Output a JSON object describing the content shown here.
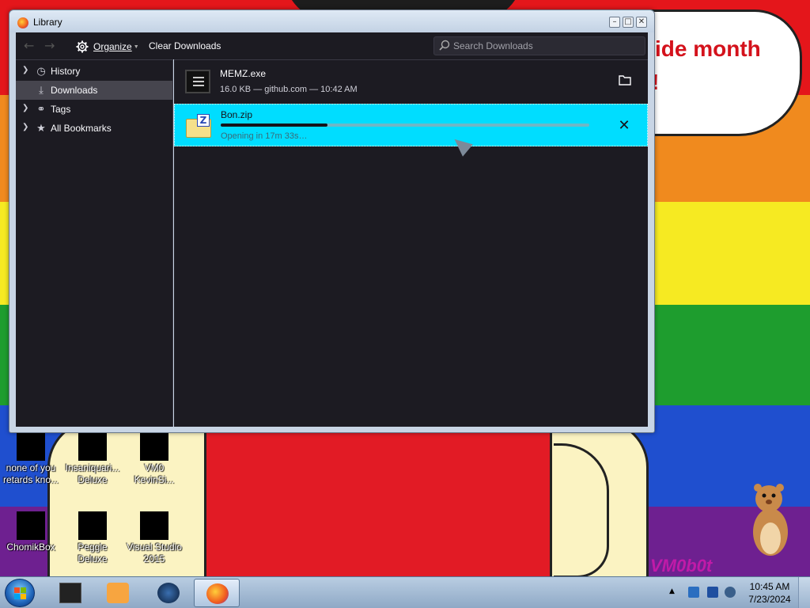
{
  "window": {
    "title": "Library",
    "controls": {
      "minimize": "–",
      "restore": "□",
      "close": "✕"
    }
  },
  "toolbar": {
    "organize_label": "Organize",
    "clear_label": "Clear Downloads",
    "search_placeholder": "Search Downloads"
  },
  "sidebar": {
    "items": [
      {
        "label": "History",
        "icon": "history-icon",
        "expandable": true,
        "selected": false
      },
      {
        "label": "Downloads",
        "icon": "download-icon",
        "expandable": false,
        "selected": true
      },
      {
        "label": "Tags",
        "icon": "tags-icon",
        "expandable": true,
        "selected": false
      },
      {
        "label": "All Bookmarks",
        "icon": "star-icon",
        "expandable": true,
        "selected": false
      }
    ]
  },
  "downloads": [
    {
      "name": "MEMZ.exe",
      "status": "16.0 KB — github.com — 10:42 AM",
      "action": "open-folder"
    },
    {
      "name": "Bon.zip",
      "status": "Opening in 17m 33s…",
      "progress": 0.29,
      "action": "cancel"
    }
  ],
  "desktop": {
    "bubble_line1": "ide month",
    "bubble_line2": "!",
    "icons": [
      {
        "label": "none of you retards kno..."
      },
      {
        "label": "Insaniquari... Deluxe"
      },
      {
        "label": "VM0 KevinSi..."
      },
      {
        "label": "ChomikBox"
      },
      {
        "label": "Peggle Deluxe"
      },
      {
        "label": "Visual Studio 2015"
      }
    ],
    "watermark": "VM0b0t"
  },
  "taskbar": {
    "time": "10:45 AM",
    "date": "7/23/2024"
  },
  "colors": {
    "accent": "#00ddff",
    "panel_bg": "#1c1b22",
    "selected_bg": "#46454e"
  }
}
